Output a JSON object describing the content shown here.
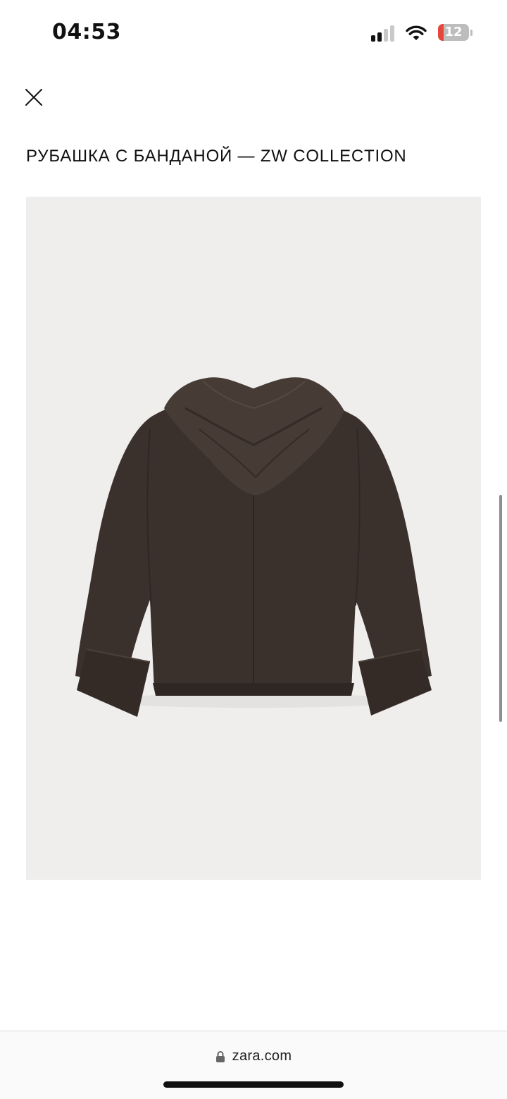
{
  "status_bar": {
    "time": "04:53",
    "battery_level": "12",
    "signal_bars_active": 2,
    "signal_bars_total": 4,
    "icons": [
      "cellular-signal-icon",
      "wifi-icon",
      "battery-icon"
    ]
  },
  "header": {
    "close_icon": "close-icon"
  },
  "product": {
    "title": "РУБАШКА С БАНДАНОЙ — ZW COLLECTION",
    "image_subject": "product-photo"
  },
  "browser": {
    "url": "zara.com",
    "lock_icon": "lock-icon"
  },
  "colors": {
    "background": "#ffffff",
    "image_background": "#efeeed",
    "garment": "#3a302b",
    "battery_low": "#e5473d"
  }
}
